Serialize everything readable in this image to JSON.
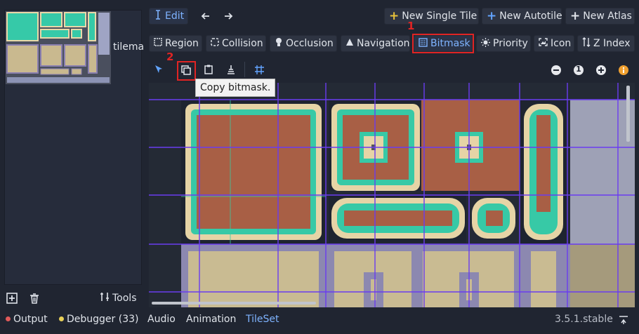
{
  "left": {
    "thumbnail_label": "tilema",
    "tools_label": "Tools"
  },
  "toolbar": {
    "edit_label": "Edit",
    "new_single_tile": "New Single Tile",
    "new_autotile": "New Autotile",
    "new_atlas": "New Atlas"
  },
  "modes": {
    "region": "Region",
    "collision": "Collision",
    "occlusion": "Occlusion",
    "navigation": "Navigation",
    "bitmask": "Bitmask",
    "priority": "Priority",
    "icon": "Icon",
    "zindex": "Z Index"
  },
  "annotations": {
    "marker_1": "1",
    "marker_2": "2"
  },
  "tooltip": "Copy bitmask.",
  "zoom": {
    "reset_label": "1"
  },
  "bottom": {
    "output": "Output",
    "debugger": "Debugger (33)",
    "audio": "Audio",
    "animation": "Animation",
    "tileset": "TileSet",
    "version": "3.5.1.stable"
  },
  "colors": {
    "accent": "#62a4ff",
    "highlight_box": "#e02424",
    "debugger_dot": "#e8d058",
    "output_dot": "#e05a5a"
  }
}
